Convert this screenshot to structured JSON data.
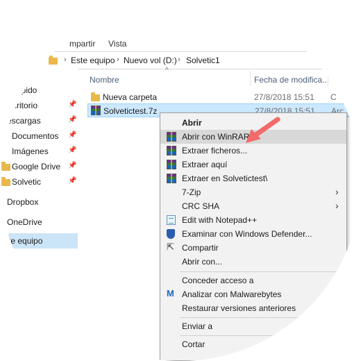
{
  "ribbon": {
    "tabs": [
      "mpartir",
      "Vista"
    ]
  },
  "address": {
    "crumbs": [
      "Este equipo",
      "Nuevo vol (D:)",
      "Solvetic1"
    ]
  },
  "nav": {
    "items": [
      {
        "label": "rápido",
        "pinned": false
      },
      {
        "label": "critorio",
        "pinned": true
      },
      {
        "label": "escargas",
        "pinned": true
      },
      {
        "label": "Documentos",
        "pinned": true
      },
      {
        "label": "Imágenes",
        "pinned": true
      },
      {
        "label": "Google Drive",
        "pinned": true
      },
      {
        "label": "Solvetic",
        "pinned": true
      },
      {
        "label": "Dropbox",
        "pinned": false
      },
      {
        "label": "OneDrive",
        "pinned": false
      },
      {
        "label": "te equipo",
        "pinned": false
      }
    ]
  },
  "columns": {
    "name": "Nombre",
    "date": "Fecha de modifica..."
  },
  "files": [
    {
      "name": "Nueva carpeta",
      "date": "27/8/2018 15:51",
      "type": "C"
    },
    {
      "name": "Solvetictest.7z",
      "date": "27/8/2018 15:51",
      "type": "Arc"
    }
  ],
  "context_menu": {
    "items": [
      {
        "label": "Abrir",
        "bold": true
      },
      {
        "label": "Abrir con WinRAR",
        "icon": "winrar-icon",
        "highlighted": true
      },
      {
        "label": "Extraer ficheros...",
        "icon": "winrar-icon"
      },
      {
        "label": "Extraer aquí",
        "icon": "winrar-icon"
      },
      {
        "label": "Extraer en Solvetictest\\",
        "icon": "winrar-icon"
      },
      {
        "label": "7-Zip",
        "submenu": true
      },
      {
        "label": "CRC SHA",
        "submenu": true
      },
      {
        "label": "Edit with Notepad++",
        "icon": "notepad-icon"
      },
      {
        "label": "Examinar con Windows Defender...",
        "icon": "shield-icon"
      },
      {
        "label": "Compartir",
        "icon": "share-icon"
      },
      {
        "label": "Abrir con..."
      },
      {
        "label": "Conceder acceso a",
        "submenu": false
      },
      {
        "label": "Analizar con Malwarebytes",
        "icon": "malwarebytes-icon"
      },
      {
        "label": "Restaurar versiones anteriores"
      },
      {
        "label": "Enviar a"
      },
      {
        "label": "Cortar"
      }
    ]
  },
  "colors": {
    "highlight": "#d8d8d8",
    "selection": "#cce8ff",
    "arrow": "#f26a6a",
    "folder": "#e8b84a"
  }
}
